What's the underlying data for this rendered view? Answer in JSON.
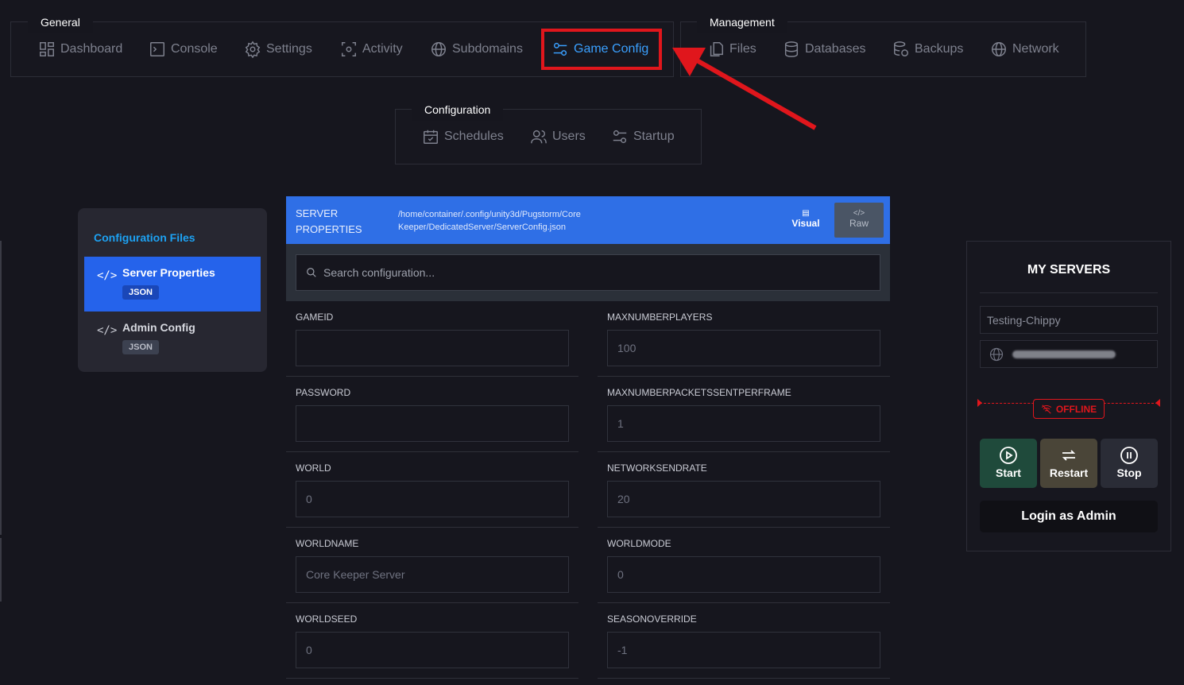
{
  "nav": {
    "general": {
      "label": "General",
      "items": [
        {
          "label": "Dashboard",
          "icon": "dashboard-icon"
        },
        {
          "label": "Console",
          "icon": "console-icon"
        },
        {
          "label": "Settings",
          "icon": "gear-icon"
        },
        {
          "label": "Activity",
          "icon": "activity-icon"
        },
        {
          "label": "Subdomains",
          "icon": "globe-icon"
        },
        {
          "label": "Game Config",
          "icon": "sliders-icon",
          "active": true
        }
      ]
    },
    "management": {
      "label": "Management",
      "items": [
        {
          "label": "Files",
          "icon": "files-icon"
        },
        {
          "label": "Databases",
          "icon": "database-icon"
        },
        {
          "label": "Backups",
          "icon": "backup-icon"
        },
        {
          "label": "Network",
          "icon": "globe-icon"
        }
      ]
    },
    "configuration": {
      "label": "Configuration",
      "items": [
        {
          "label": "Schedules",
          "icon": "calendar-icon"
        },
        {
          "label": "Users",
          "icon": "users-icon"
        },
        {
          "label": "Startup",
          "icon": "sliders-icon"
        }
      ]
    }
  },
  "config_files": {
    "title": "Configuration Files",
    "items": [
      {
        "name": "Server Properties",
        "badge": "JSON",
        "active": true
      },
      {
        "name": "Admin Config",
        "badge": "JSON",
        "active": false
      }
    ]
  },
  "editor": {
    "title": "SERVER PROPERTIES",
    "path": "/home/container/.config/unity3d/Pugstorm/Core Keeper/DedicatedServer/ServerConfig.json",
    "visual_label": "Visual",
    "raw_label": "Raw",
    "search_placeholder": "Search configuration...",
    "fields": [
      {
        "label": "GAMEID",
        "value": ""
      },
      {
        "label": "MAXNUMBERPLAYERS",
        "value": "100"
      },
      {
        "label": "PASSWORD",
        "value": ""
      },
      {
        "label": "MAXNUMBERPACKETSSENTPERFRAME",
        "value": "1"
      },
      {
        "label": "WORLD",
        "value": "0"
      },
      {
        "label": "NETWORKSENDRATE",
        "value": "20"
      },
      {
        "label": "WORLDNAME",
        "value": "Core Keeper Server"
      },
      {
        "label": "WORLDMODE",
        "value": "0"
      },
      {
        "label": "WORLDSEED",
        "value": "0"
      },
      {
        "label": "SEASONOVERRIDE",
        "value": "-1"
      }
    ]
  },
  "servers": {
    "title": "MY SERVERS",
    "server_name": "Testing-Chippy",
    "status": "OFFLINE",
    "start_label": "Start",
    "restart_label": "Restart",
    "stop_label": "Stop",
    "login_label": "Login as Admin"
  },
  "colors": {
    "accent": "#3aa0ff",
    "highlight": "#e0161c",
    "editor_header": "#2f6fe6",
    "active_item": "#2563eb"
  }
}
